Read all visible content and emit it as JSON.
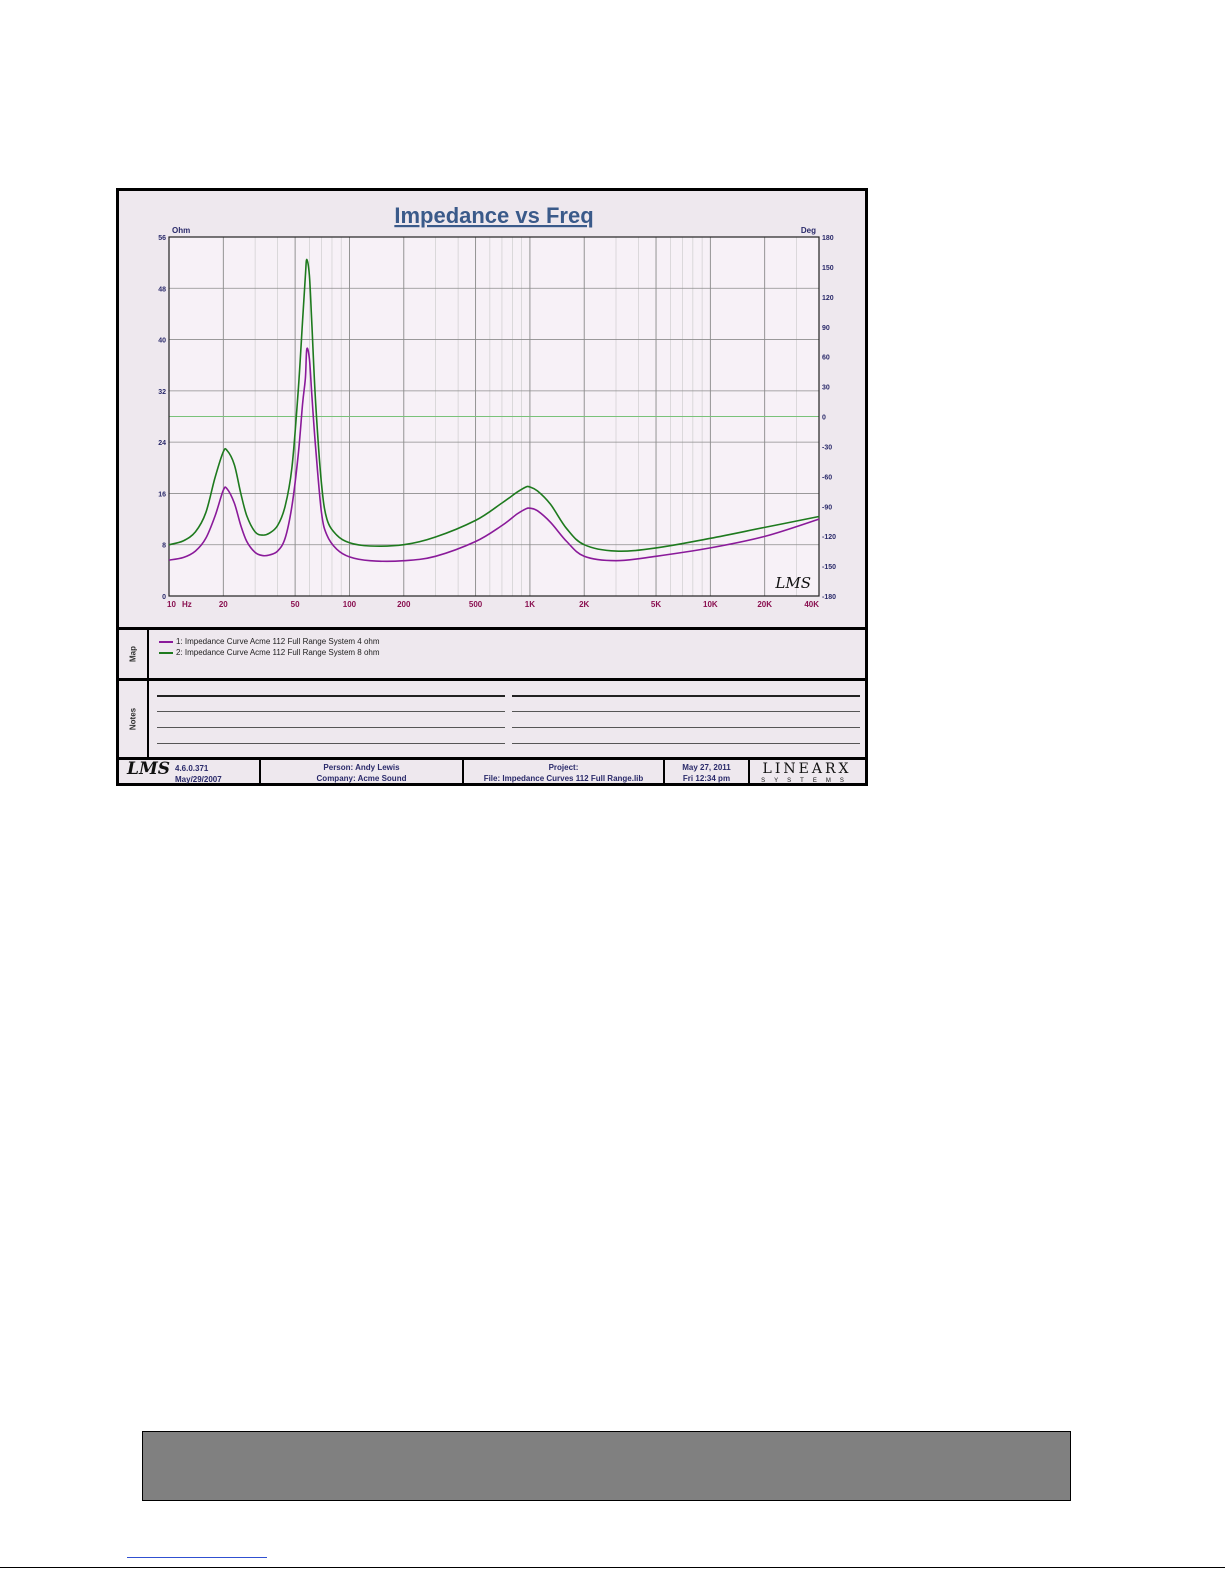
{
  "chart_data": {
    "type": "line",
    "title": "Impedance vs Freq",
    "left_axis": {
      "unit": "Ohm",
      "range": [
        0,
        56
      ],
      "ticks": [
        0,
        8,
        16,
        24,
        32,
        40,
        48,
        56
      ]
    },
    "right_axis": {
      "unit": "Deg",
      "range": [
        -180,
        180
      ],
      "ticks": [
        -180,
        -150,
        -120,
        -90,
        -60,
        -30,
        0,
        30,
        60,
        90,
        120,
        150,
        180
      ]
    },
    "x_axis": {
      "scale": "log",
      "range": [
        10,
        40000
      ],
      "unit": "Hz",
      "ticks": [
        {
          "value": 10,
          "label": "10"
        },
        {
          "value": 20,
          "label": "20"
        },
        {
          "value": 50,
          "label": "50"
        },
        {
          "value": 100,
          "label": "100"
        },
        {
          "value": 200,
          "label": "200"
        },
        {
          "value": 500,
          "label": "500"
        },
        {
          "value": 1000,
          "label": "1K"
        },
        {
          "value": 2000,
          "label": "2K"
        },
        {
          "value": 5000,
          "label": "5K"
        },
        {
          "value": 10000,
          "label": "10K"
        },
        {
          "value": 20000,
          "label": "20K"
        },
        {
          "value": 40000,
          "label": "40K"
        }
      ]
    },
    "grid": true,
    "series": [
      {
        "name": "1: Impedance Curve Acme 112 Full Range System 4 ohm",
        "color": "#8a1a9a",
        "points": [
          [
            10,
            5.6
          ],
          [
            12,
            6
          ],
          [
            14,
            7
          ],
          [
            16,
            9
          ],
          [
            18,
            12.5
          ],
          [
            20,
            16.5
          ],
          [
            21,
            16.7
          ],
          [
            23,
            14.5
          ],
          [
            25,
            11
          ],
          [
            27,
            8.5
          ],
          [
            30,
            6.8
          ],
          [
            33,
            6.3
          ],
          [
            36,
            6.4
          ],
          [
            40,
            7
          ],
          [
            44,
            9
          ],
          [
            48,
            14
          ],
          [
            52,
            22
          ],
          [
            55,
            30
          ],
          [
            57,
            34
          ],
          [
            58,
            38.5
          ],
          [
            60,
            37
          ],
          [
            62,
            31
          ],
          [
            65,
            23
          ],
          [
            70,
            13
          ],
          [
            75,
            9.5
          ],
          [
            85,
            7.3
          ],
          [
            100,
            6.1
          ],
          [
            130,
            5.5
          ],
          [
            200,
            5.5
          ],
          [
            300,
            6.2
          ],
          [
            500,
            8.5
          ],
          [
            700,
            11
          ],
          [
            850,
            12.8
          ],
          [
            950,
            13.6
          ],
          [
            1000,
            13.7
          ],
          [
            1100,
            13.3
          ],
          [
            1300,
            11.5
          ],
          [
            1600,
            8.5
          ],
          [
            2000,
            6.2
          ],
          [
            3000,
            5.5
          ],
          [
            5000,
            6.2
          ],
          [
            10000,
            7.5
          ],
          [
            20000,
            9.3
          ],
          [
            40000,
            12
          ]
        ]
      },
      {
        "name": "2: Impedance Curve Acme 112 Full Range System 8 ohm",
        "color": "#1e7a1e",
        "points": [
          [
            10,
            8
          ],
          [
            12,
            8.6
          ],
          [
            14,
            10
          ],
          [
            16,
            13
          ],
          [
            18,
            18.5
          ],
          [
            20,
            22.5
          ],
          [
            21,
            22.7
          ],
          [
            23,
            20.5
          ],
          [
            25,
            16
          ],
          [
            27,
            12.5
          ],
          [
            30,
            10
          ],
          [
            33,
            9.5
          ],
          [
            36,
            9.8
          ],
          [
            40,
            11
          ],
          [
            44,
            14
          ],
          [
            48,
            20
          ],
          [
            52,
            32
          ],
          [
            55,
            43
          ],
          [
            57,
            50
          ],
          [
            58,
            52.5
          ],
          [
            60,
            50
          ],
          [
            62,
            42
          ],
          [
            65,
            30
          ],
          [
            70,
            17.5
          ],
          [
            75,
            12
          ],
          [
            85,
            9.5
          ],
          [
            100,
            8.3
          ],
          [
            130,
            7.8
          ],
          [
            200,
            8
          ],
          [
            300,
            9.2
          ],
          [
            500,
            11.8
          ],
          [
            700,
            14.5
          ],
          [
            850,
            16.2
          ],
          [
            950,
            17
          ],
          [
            1000,
            17
          ],
          [
            1100,
            16.4
          ],
          [
            1300,
            14.3
          ],
          [
            1600,
            10.5
          ],
          [
            2000,
            8
          ],
          [
            3000,
            7
          ],
          [
            5000,
            7.5
          ],
          [
            10000,
            9
          ],
          [
            20000,
            10.7
          ],
          [
            40000,
            12.4
          ]
        ]
      }
    ],
    "reference_line": {
      "phase_deg": 0,
      "color": "#7ac27a"
    }
  },
  "map": {
    "label": "Map",
    "entries": [
      "1: Impedance Curve Acme 112 Full Range System 4 ohm",
      "2: Impedance Curve Acme 112 Full Range System 8 ohm"
    ]
  },
  "notes": {
    "label": "Notes"
  },
  "footer": {
    "logo": "LMS",
    "version": "4.6.0.371",
    "version_date": "May/29/2007",
    "person": "Person: Andy Lewis",
    "company": "Company: Acme Sound",
    "project": "Project:",
    "file": "File: Impedance Curves 112 Full Range.lib",
    "date": "May 27, 2011",
    "time": "Fri 12:34 pm",
    "brand_top": "LINEARX",
    "brand_bottom": "SYSTEMS"
  },
  "watermark": "LMS",
  "colors": {
    "background": "#eee8ee",
    "grid_major": "#8c8c8c",
    "grid_minor": "#c8c8c8",
    "tick_label": "#8a1050",
    "title": "#3a5a8a"
  }
}
